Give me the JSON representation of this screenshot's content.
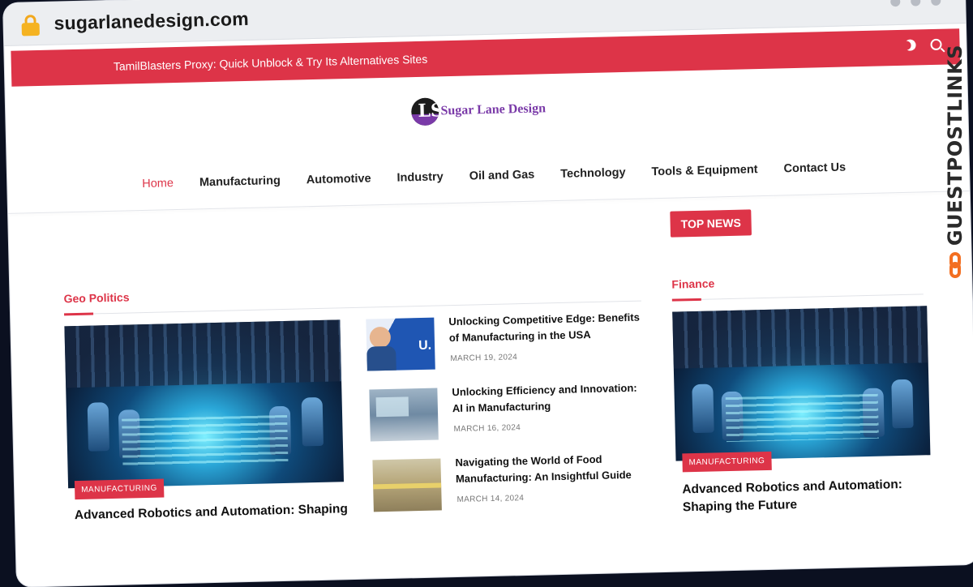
{
  "browser": {
    "url": "sugarlanedesign.com"
  },
  "topbar": {
    "ticker": "TamilBlasters Proxy: Quick Unblock & Try Its Alternatives Sites",
    "icons": [
      "moon-icon",
      "search-icon"
    ]
  },
  "logo": {
    "mark_letters": "LS",
    "text": "Sugar Lane Design"
  },
  "nav": {
    "items": [
      "Home",
      "Manufacturing",
      "Automotive",
      "Industry",
      "Oil and Gas",
      "Technology",
      "Tools & Equipment",
      "Contact Us"
    ],
    "active": "Home"
  },
  "top_news": {
    "label": "TOP NEWS"
  },
  "geo_politics": {
    "title": "Geo Politics",
    "featured": {
      "category": "MANUFACTURING",
      "title": "Advanced Robotics and Automation: Shaping"
    },
    "items": [
      {
        "title": "Unlocking Competitive Edge: Benefits of Manufacturing in the USA",
        "date": "MARCH 19, 2024",
        "thumb_text": "U."
      },
      {
        "title": "Unlocking Efficiency and Innovation: AI in Manufacturing",
        "date": "MARCH 16, 2024"
      },
      {
        "title": "Navigating the World of Food Manufacturing: An Insightful Guide",
        "date": "MARCH 14, 2024"
      }
    ]
  },
  "finance": {
    "title": "Finance",
    "featured": {
      "category": "MANUFACTURING",
      "title": "Advanced Robotics and Automation: Shaping the Future"
    }
  },
  "watermark": {
    "text": "GUESTPOSTLINKS"
  },
  "colors": {
    "accent": "#dd3448",
    "logo_purple": "#7a3aa8",
    "watermark_orange": "#f36f21"
  }
}
